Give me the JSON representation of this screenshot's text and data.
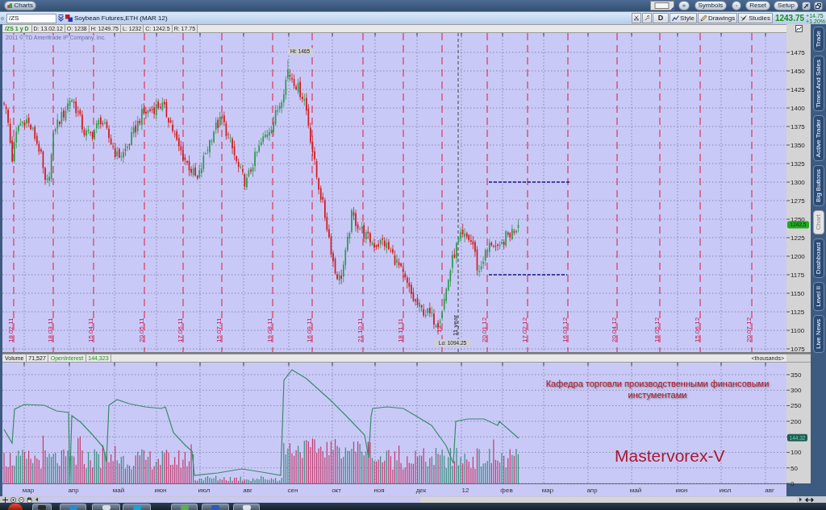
{
  "window": {
    "tab": "Charts",
    "buttons": [
      "Symbols",
      "Reset",
      "Setup"
    ]
  },
  "toolbar": {
    "symbol": "/ZS",
    "description": "Soybean Futures,ETH (MAR 12)",
    "aggregation": "D",
    "buttons": [
      "Style",
      "Drawings",
      "Studies"
    ],
    "last_price": "1243.75",
    "net_change": "+14.75",
    "percent_change": "+1.20%"
  },
  "info_bar": {
    "study": "/ZS 1 y D",
    "fields": [
      "D: 13.02.12",
      "O: 1238",
      "H: 1249.75",
      "L: 1232",
      "C: 1242.5",
      "R: 17.75"
    ]
  },
  "price_chart": {
    "copyright": "2011 © TD Ameritrade IP Company, Inc.",
    "high_label": "Hi: 1465",
    "low_label": "Lo: 1094.25",
    "period_marker": "11 year",
    "price_tag": "1242.5",
    "y_labels": [
      "1475",
      "1450",
      "1425",
      "1400",
      "1375",
      "1350",
      "1325",
      "1300",
      "1275",
      "1250",
      "1225",
      "1200",
      "1175",
      "1150",
      "1125",
      "1100",
      "1075"
    ],
    "date_labels": [
      "18.02.11",
      "18.03.11",
      "15.04.11",
      "20.05.11",
      "17.06.11",
      "15.07.11",
      "19.08.11",
      "16.09.11",
      "21.10.11",
      "18.11.11",
      "12",
      "20.01.12",
      "17.02.12",
      "16.03.12",
      "20.04.12",
      "18.05.12",
      "15.06.12",
      "20.07.12"
    ]
  },
  "volume_panel": {
    "legend": [
      {
        "kind": "volume",
        "label": "Volume",
        "value": "71,527"
      },
      {
        "kind": "open_interest",
        "label": "OpenInterest",
        "value": "144,323"
      }
    ],
    "units": "<thousands>",
    "y_labels": [
      "350",
      "300",
      "250",
      "200",
      "100",
      "50",
      "0"
    ],
    "value_tag": "144.32",
    "month_labels": [
      "мар",
      "апр",
      "май",
      "июн",
      "июл",
      "авг",
      "сен",
      "окт",
      "ноя",
      "дек",
      "12",
      "фев",
      "мар",
      "апр",
      "май",
      "июн",
      "июл",
      "авг"
    ]
  },
  "annotation": {
    "text": "Кафедра торговли производственными финансовыми инстументами",
    "signature": "Mastervorex-V"
  },
  "side_tabs": [
    {
      "label": "Trade",
      "selected": false
    },
    {
      "label": "Times And Sales",
      "selected": false
    },
    {
      "label": "Active Trader",
      "selected": false
    },
    {
      "label": "Big Buttons",
      "selected": false
    },
    {
      "label": "Chart",
      "selected": true
    },
    {
      "label": "Dashboard",
      "selected": false
    },
    {
      "label": "Level II",
      "selected": false
    },
    {
      "label": "Live News",
      "selected": false
    }
  ]
}
